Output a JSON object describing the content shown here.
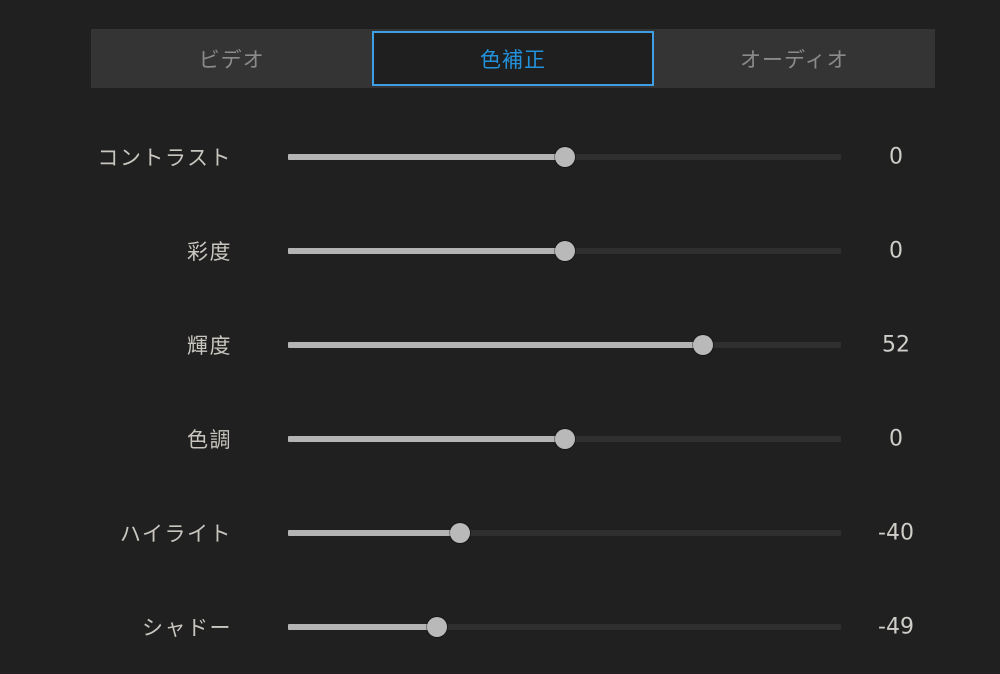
{
  "panel": {
    "background_color": "#202020",
    "tabbar_color": "#343434",
    "accent_color": "#3f9fe4",
    "active_tab_text_color": "#2392dc",
    "inactive_tab_text_color": "#8b8b8b",
    "label_color": "#c9c6c0",
    "track_color": "#2f2f2f",
    "track_fill_color": "#b4b4b4",
    "thumb_color": "#b9b9b9"
  },
  "tabs": [
    {
      "id": "video",
      "label": "ビデオ",
      "active": false
    },
    {
      "id": "color-correction",
      "label": "色補正",
      "active": true
    },
    {
      "id": "audio",
      "label": "オーディオ",
      "active": false
    }
  ],
  "sliders": [
    {
      "id": "contrast",
      "label": "コントラスト",
      "value": "0",
      "percent": 50.1
    },
    {
      "id": "saturation",
      "label": "彩度",
      "value": "0",
      "percent": 50.1
    },
    {
      "id": "brightness",
      "label": "輝度",
      "value": "52",
      "percent": 75.0
    },
    {
      "id": "hue",
      "label": "色調",
      "value": "0",
      "percent": 50.1
    },
    {
      "id": "highlights",
      "label": "ハイライト",
      "value": "-40",
      "percent": 31.1
    },
    {
      "id": "shadows",
      "label": "シャドー",
      "value": "-49",
      "percent": 26.9
    }
  ]
}
